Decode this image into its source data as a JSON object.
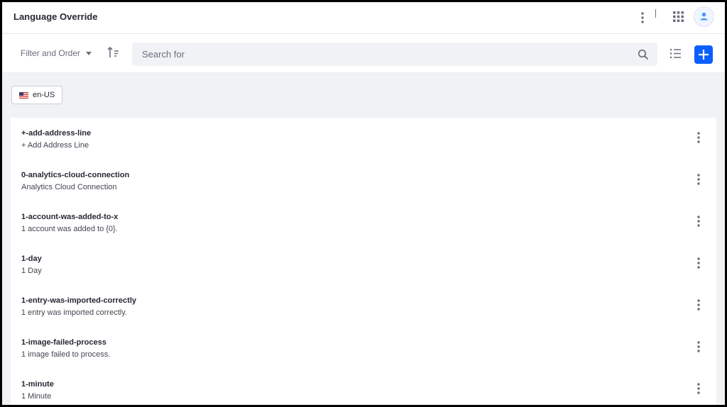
{
  "header": {
    "title": "Language Override"
  },
  "toolbar": {
    "filter_label": "Filter and Order",
    "search_placeholder": "Search for"
  },
  "locale": {
    "label": "en-US"
  },
  "colors": {
    "accent": "#0b5fff",
    "background": "#f1f2f5",
    "text": "#272833",
    "muted": "#6b6c7e"
  },
  "icons": {
    "header_menu": "kebab-icon",
    "apps": "apps-grid-icon",
    "avatar": "user-icon",
    "filter_caret": "caret-down-icon",
    "sort": "sort-icon",
    "search": "search-icon",
    "list_view": "list-view-icon",
    "add": "plus-icon",
    "flag": "us-flag-icon",
    "row_menu": "kebab-icon"
  },
  "entries": [
    {
      "key": "+-add-address-line",
      "value": "+ Add Address Line"
    },
    {
      "key": "0-analytics-cloud-connection",
      "value": "Analytics Cloud Connection"
    },
    {
      "key": "1-account-was-added-to-x",
      "value": "1 account was added to {0}."
    },
    {
      "key": "1-day",
      "value": "1 Day"
    },
    {
      "key": "1-entry-was-imported-correctly",
      "value": "1 entry was imported correctly."
    },
    {
      "key": "1-image-failed-process",
      "value": "1 image failed to process."
    },
    {
      "key": "1-minute",
      "value": "1 Minute"
    }
  ]
}
